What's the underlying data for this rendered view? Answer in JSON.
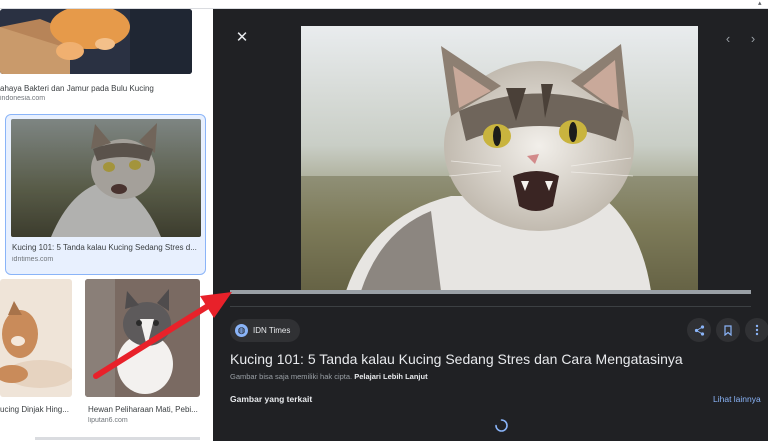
{
  "results": [
    {
      "caption": "ahaya Bakteri dan Jamur pada Bulu Kucing",
      "source": "indonesia.com"
    },
    {
      "caption": "Kucing 101: 5 Tanda kalau Kucing Sedang Stres d...",
      "source": "idntimes.com"
    },
    {
      "caption": "ucing Dinjak Hing...",
      "source": ""
    },
    {
      "caption": "Hewan Peliharaan Mati, Pebi...",
      "source": "liputan6.com"
    }
  ],
  "viewer": {
    "close_icon": "close-icon",
    "source_chip": "IDN Times",
    "title": "Kucing 101: 5 Tanda kalau Kucing Sedang Stres dan Cara Mengatasinya",
    "copyright_note": "Gambar bisa saja memiliki hak cipta.",
    "learn_more": "Pelajari Lebih Lanjut",
    "related_heading": "Gambar yang terkait",
    "see_more": "Lihat lainnya",
    "load_progress": 1.0
  },
  "colors": {
    "viewer_bg": "#202124",
    "accent": "#8ab4f8",
    "arrow": "#e8212a"
  }
}
